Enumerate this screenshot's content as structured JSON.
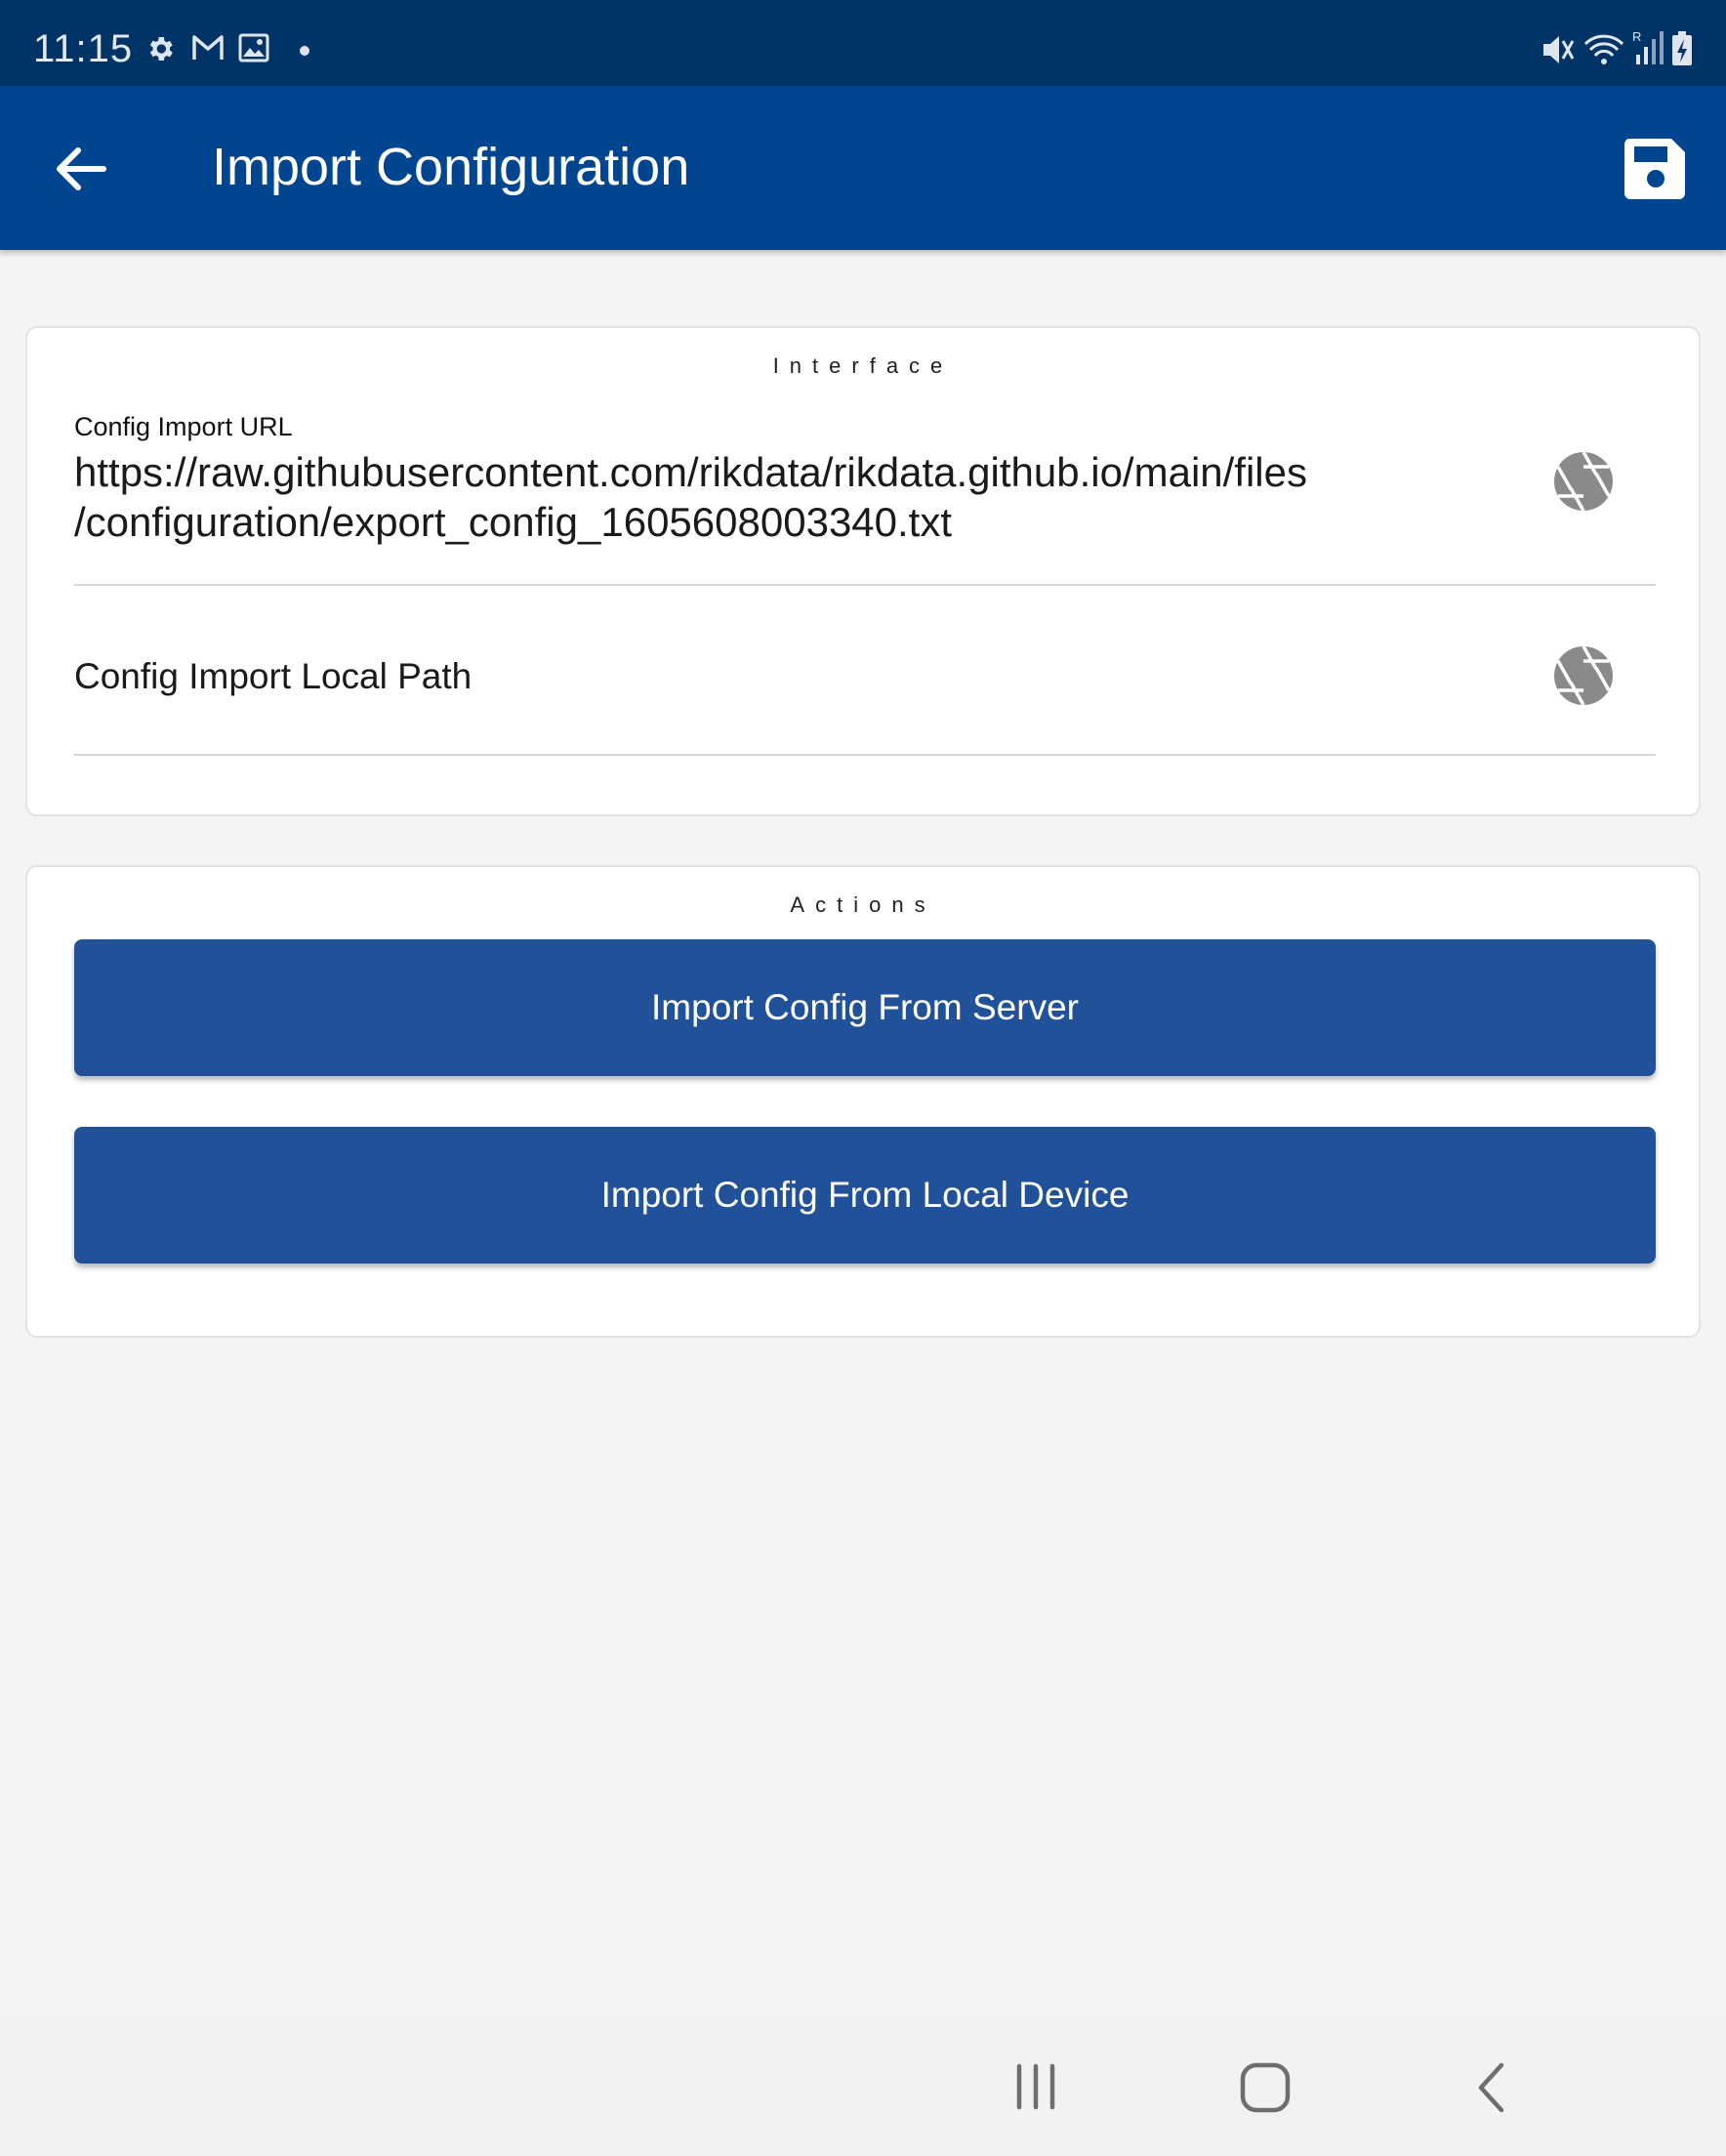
{
  "status_bar": {
    "time": "11:15",
    "left_icons": [
      "gear-icon",
      "gmail-icon",
      "image-icon",
      "dot-icon"
    ],
    "right_icons": [
      "mute-icon",
      "wifi-icon",
      "signal-icon",
      "battery-charging-icon"
    ]
  },
  "app_bar": {
    "title": "Import Configuration",
    "back_icon": "arrow-left-icon",
    "save_icon": "floppy-disk-icon",
    "background_color": "#004590"
  },
  "interface_card": {
    "title": "Interface",
    "url_field": {
      "label": "Config Import URL",
      "value_line1": "https://raw.githubusercontent.com/rikdata/rikdata.github.io/main/files",
      "value_line2": "/configuration/export_config_1605608003340.txt",
      "icon": "aperture-icon"
    },
    "local_path_field": {
      "label": "Config Import Local Path",
      "icon": "aperture-icon"
    }
  },
  "actions_card": {
    "title": "Actions",
    "buttons": [
      {
        "label": "Import Config From Server"
      },
      {
        "label": "Import Config From Local Device"
      }
    ],
    "button_color": "#215299"
  },
  "nav_bar": {
    "icons": [
      "recent-apps-icon",
      "home-icon",
      "back-chevron-icon"
    ]
  }
}
